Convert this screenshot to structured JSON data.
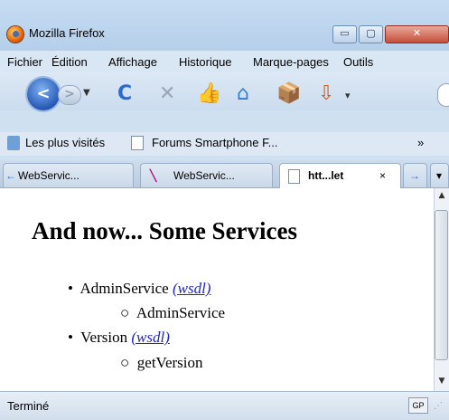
{
  "window": {
    "title": "Mozilla Firefox",
    "controls": {
      "minimize": "▭",
      "maximize": "▢",
      "close": "✕"
    }
  },
  "menu": [
    "Fichier",
    "Édition",
    "Affichage",
    "Historique",
    "Marque-pages",
    "Outils"
  ],
  "nav": {
    "back_icon": "back-arrow-icon",
    "forward_icon": "forward-arrow-icon",
    "icons": [
      "reload-icon",
      "stop-icon",
      "thumbs-up-icon",
      "home-icon",
      "download-icon",
      "addon-icon"
    ]
  },
  "bookmarks": [
    {
      "label": "Les plus visités",
      "icon": "bookmarks-icon"
    },
    {
      "label": "Forums Smartphone F...",
      "icon": "page-icon"
    }
  ],
  "bookmarks_overflow": "»",
  "tabs": [
    {
      "label": "WebServic...",
      "active": false
    },
    {
      "label": "WebServic...",
      "active": false
    },
    {
      "label": "htt...let",
      "active": true,
      "close": "×"
    }
  ],
  "tab_scroll_right": "→",
  "tab_list": "▾",
  "page": {
    "heading": "And now... Some Services",
    "services": [
      {
        "name": "AdminService",
        "wsdl_label": "(wsdl)",
        "methods": [
          "AdminService"
        ]
      },
      {
        "name": "Version",
        "wsdl_label": "(wsdl)",
        "methods": [
          "getVersion"
        ]
      }
    ]
  },
  "status": {
    "text": "Terminé",
    "badge": "GP"
  },
  "colors": {
    "link": "#1f26c5",
    "chrome": "#cfe0f1",
    "close_button": "#c44e3a"
  }
}
